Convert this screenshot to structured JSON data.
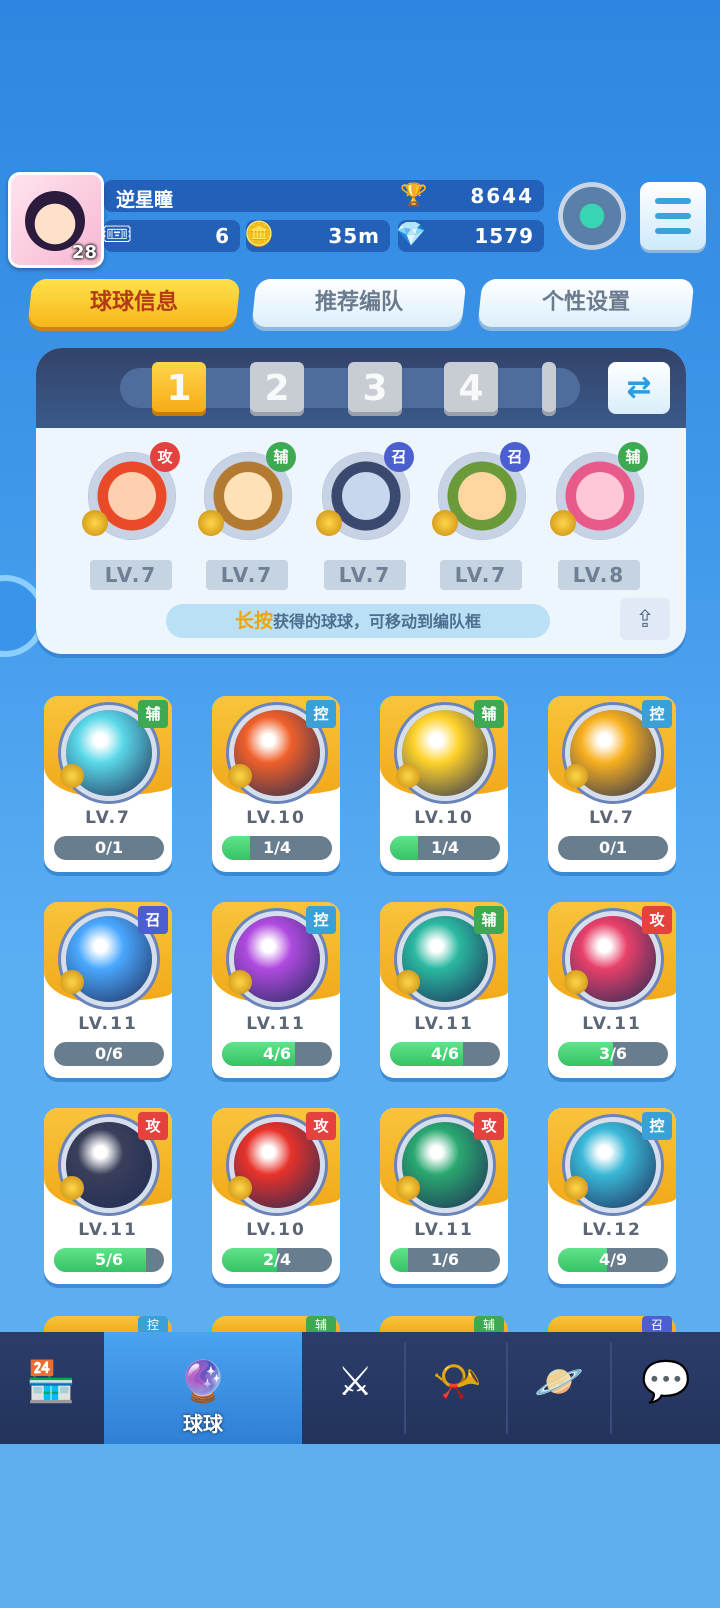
{
  "player": {
    "name": "逆星瞳",
    "level": "28",
    "trophies": "8644"
  },
  "resources": {
    "tickets": "6",
    "coins": "35m",
    "diamonds": "1579"
  },
  "tabs": [
    {
      "label": "球球信息",
      "active": true
    },
    {
      "label": "推荐编队",
      "active": false
    },
    {
      "label": "个性设置",
      "active": false
    }
  ],
  "team_slots": [
    "1",
    "2",
    "3",
    "4"
  ],
  "team": [
    {
      "tag": "攻",
      "role": "atk",
      "level": "LV.7",
      "colors": [
        "#ffd0b0",
        "#e84a2a"
      ]
    },
    {
      "tag": "辅",
      "role": "sup",
      "level": "LV.7",
      "colors": [
        "#ffe1b8",
        "#b57a32"
      ]
    },
    {
      "tag": "召",
      "role": "sum",
      "level": "LV.7",
      "colors": [
        "#c8d6ee",
        "#3a4a6e"
      ]
    },
    {
      "tag": "召",
      "role": "sum",
      "level": "LV.7",
      "colors": [
        "#ffd6a0",
        "#6a9a3a"
      ]
    },
    {
      "tag": "辅",
      "role": "sup",
      "level": "LV.8",
      "colors": [
        "#ffc8d6",
        "#e85a8a"
      ]
    }
  ],
  "hint": {
    "highlight": "长按",
    "text": "获得的球球，可移动到编队框"
  },
  "balls": [
    {
      "tag": "辅",
      "role": "sup",
      "level": "LV.7",
      "progress": "0/1",
      "fill": 0,
      "color": "#5ad8e8"
    },
    {
      "tag": "控",
      "role": "ctl",
      "level": "LV.10",
      "progress": "1/4",
      "fill": 0.25,
      "color": "#f0602a"
    },
    {
      "tag": "辅",
      "role": "sup",
      "level": "LV.10",
      "progress": "1/4",
      "fill": 0.25,
      "color": "#ffd22a"
    },
    {
      "tag": "控",
      "role": "ctl",
      "level": "LV.7",
      "progress": "0/1",
      "fill": 0,
      "color": "#f8b020"
    },
    {
      "tag": "召",
      "role": "sum",
      "level": "LV.11",
      "progress": "0/6",
      "fill": 0,
      "color": "#4aa8ff"
    },
    {
      "tag": "控",
      "role": "ctl",
      "level": "LV.11",
      "progress": "4/6",
      "fill": 0.6667,
      "color": "#b04ae0"
    },
    {
      "tag": "辅",
      "role": "sup",
      "level": "LV.11",
      "progress": "4/6",
      "fill": 0.6667,
      "color": "#2ab8a0"
    },
    {
      "tag": "攻",
      "role": "atk",
      "level": "LV.11",
      "progress": "3/6",
      "fill": 0.5,
      "color": "#e8406a"
    },
    {
      "tag": "攻",
      "role": "atk",
      "level": "LV.11",
      "progress": "5/6",
      "fill": 0.8333,
      "color": "#3a3f5a"
    },
    {
      "tag": "攻",
      "role": "atk",
      "level": "LV.10",
      "progress": "2/4",
      "fill": 0.5,
      "color": "#e8322a"
    },
    {
      "tag": "攻",
      "role": "atk",
      "level": "LV.11",
      "progress": "1/6",
      "fill": 0.1667,
      "color": "#2aa870"
    },
    {
      "tag": "控",
      "role": "ctl",
      "level": "LV.12",
      "progress": "4/9",
      "fill": 0.4444,
      "color": "#3ab8d8"
    }
  ],
  "peek_tags": [
    {
      "tag": "控",
      "role": "ctl"
    },
    {
      "tag": "辅",
      "role": "sup"
    },
    {
      "tag": "辅",
      "role": "sup"
    },
    {
      "tag": "召",
      "role": "sum"
    }
  ],
  "nav": [
    {
      "icon": "shop-icon",
      "glyph": "🏪",
      "label": ""
    },
    {
      "icon": "ball-icon",
      "glyph": "🔮",
      "label": "球球",
      "active": true
    },
    {
      "icon": "battle-swords-icon",
      "glyph": "⚔",
      "label": ""
    },
    {
      "icon": "whistle-icon",
      "glyph": "📯",
      "label": ""
    },
    {
      "icon": "planet-icon",
      "glyph": "🪐",
      "label": ""
    },
    {
      "icon": "chat-heart-icon",
      "glyph": "💬",
      "label": ""
    }
  ]
}
